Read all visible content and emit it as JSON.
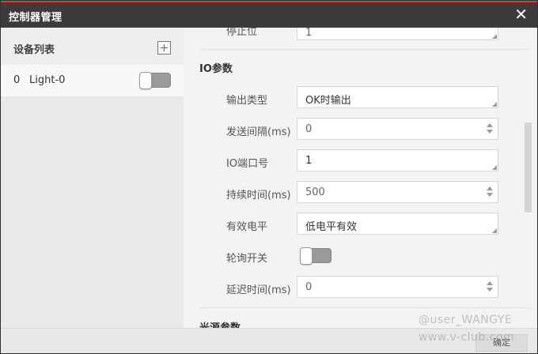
{
  "window": {
    "title": "控制器管理"
  },
  "sidebar": {
    "title": "设备列表",
    "items": [
      {
        "index": "0",
        "name": "Light-0",
        "enabled": false
      }
    ]
  },
  "content": {
    "top_partial": {
      "label": "停止位",
      "value": "1"
    },
    "io_section": {
      "title": "IO参数",
      "fields": [
        {
          "label": "输出类型",
          "value": "OK时输出",
          "type": "dropdown"
        },
        {
          "label": "发送间隔(ms)",
          "value": "0",
          "type": "spinner"
        },
        {
          "label": "IO端口号",
          "value": "1",
          "type": "dropdown"
        },
        {
          "label": "持续时间(ms)",
          "value": "500",
          "type": "spinner"
        },
        {
          "label": "有效电平",
          "value": "低电平有效",
          "type": "dropdown"
        },
        {
          "label": "轮询开关",
          "value": false,
          "type": "toggle"
        },
        {
          "label": "延迟时间(ms)",
          "value": "0",
          "type": "spinner"
        }
      ]
    },
    "light_section": {
      "title": "光源参数"
    }
  },
  "footer": {
    "ok_label": "确定"
  },
  "watermark": {
    "line1": "@user_WANGYE",
    "line2": "www.v-club.com"
  },
  "colors": {
    "accent_top": "#e03a2f",
    "titlebar": "#3b3b3b"
  }
}
